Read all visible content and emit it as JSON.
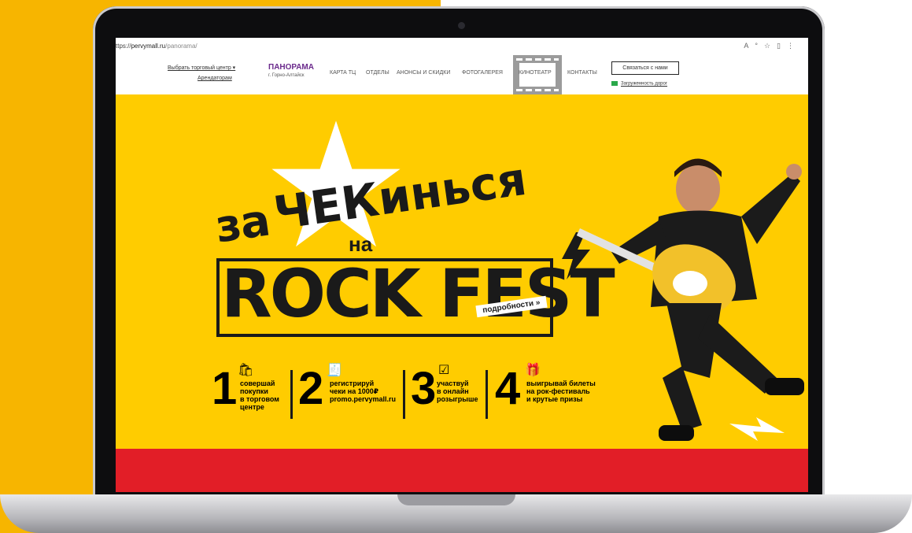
{
  "browser": {
    "url_scheme": "ttps://",
    "url_host": "pervymall.ru",
    "url_path": "/panorama/",
    "icons": [
      "read-aloud-icon",
      "favorite-icon",
      "split-screen-icon",
      "sidebar-icon"
    ]
  },
  "site_header": {
    "choose_mall": "Выбрать торговый центр ▾",
    "tenants": "Арендаторам",
    "logo": "ПАНОРАМА",
    "logo_city": "г. Горно-Алтайск",
    "nav": [
      "КАРТА ТЦ",
      "ОТДЕЛЫ",
      "АНОНСЫ И СКИДКИ",
      "ФОТОГАЛЕРЕЯ",
      "КИНОТЕАТР",
      "КОНТАКТЫ"
    ],
    "contact_button": "Связаться с нами",
    "traffic_link": "Загруженность дорог"
  },
  "banner": {
    "line1_za": "за",
    "line1_chek": "ЧЕКинься",
    "line2_na": "на",
    "rock_fest": "ROCK FEST",
    "details": "подробности »",
    "steps": [
      {
        "num": "1",
        "icon": "shopping-bag-icon",
        "text": "совершай\nпокупки\nв торговом\nцентре"
      },
      {
        "num": "2",
        "icon": "receipt-icon",
        "text": "регистрируй\nчеки на 1000₽\npromo.pervymall.ru"
      },
      {
        "num": "3",
        "icon": "lottery-icon",
        "text": "участвуй\nв онлайн\nрозыгрыше"
      },
      {
        "num": "4",
        "icon": "gift-icon",
        "text": "выигрывай билеты\nна рок-фестиваль\nи крутые призы"
      }
    ]
  },
  "colors": {
    "banner_bg": "#ffcc00",
    "accent_red": "#e21e27",
    "logo_purple": "#6b2a8c",
    "page_yellow": "#f7b500"
  }
}
